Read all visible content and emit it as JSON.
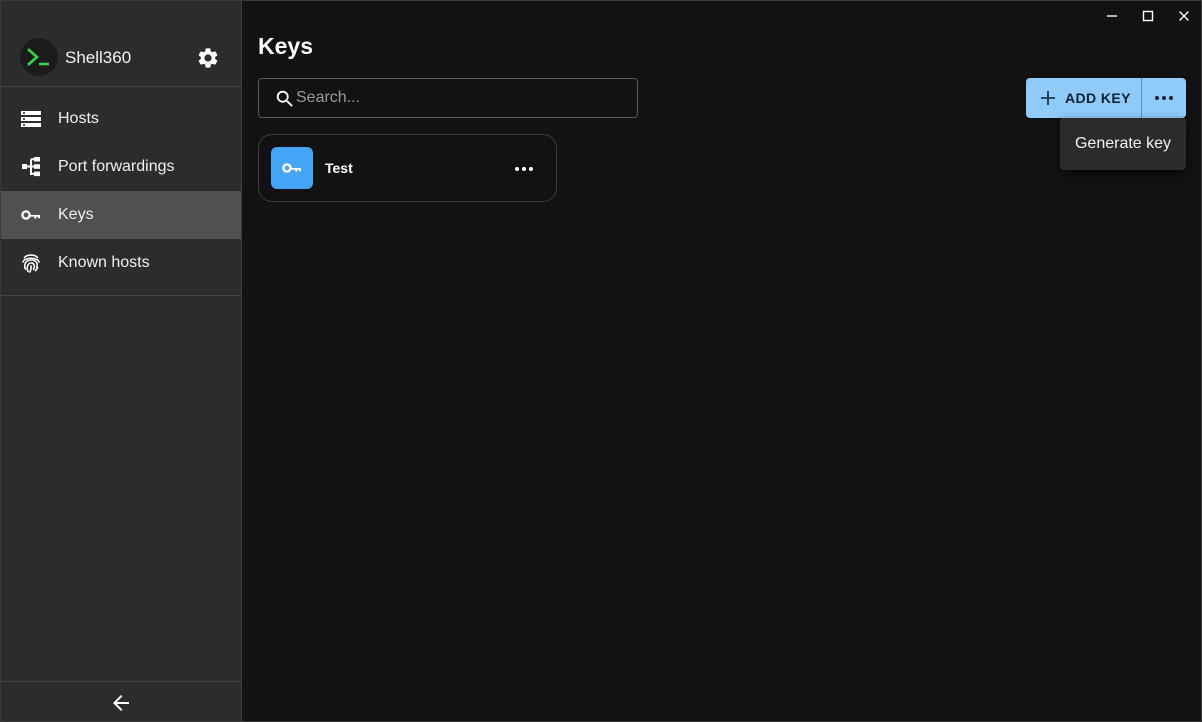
{
  "app": {
    "name": "Shell360"
  },
  "icons": {
    "logo": "terminal-prompt-icon",
    "settings": "gear-icon",
    "back": "arrow-left-icon",
    "search": "search-icon",
    "add": "plus-icon",
    "more": "more-horizontal-icon"
  },
  "sidebar": {
    "items": [
      {
        "label": "Hosts",
        "icon": "server-icon",
        "active": false
      },
      {
        "label": "Port forwardings",
        "icon": "port-forward-icon",
        "active": false
      },
      {
        "label": "Keys",
        "icon": "key-icon",
        "active": true
      },
      {
        "label": "Known hosts",
        "icon": "fingerprint-icon",
        "active": false
      }
    ]
  },
  "main": {
    "title": "Keys",
    "search": {
      "placeholder": "Search...",
      "value": ""
    },
    "add_button_label": "ADD KEY",
    "menu": {
      "items": [
        "Generate key"
      ]
    },
    "keys": [
      {
        "name": "Test",
        "icon": "key-icon"
      }
    ]
  },
  "colors": {
    "accent": "#90caf9",
    "key_avatar": "#42a5f5",
    "logo_prompt": "#35d64a",
    "sidebar_bg": "#2c2c2c",
    "main_bg": "#121212",
    "active_item_bg": "#505050"
  }
}
